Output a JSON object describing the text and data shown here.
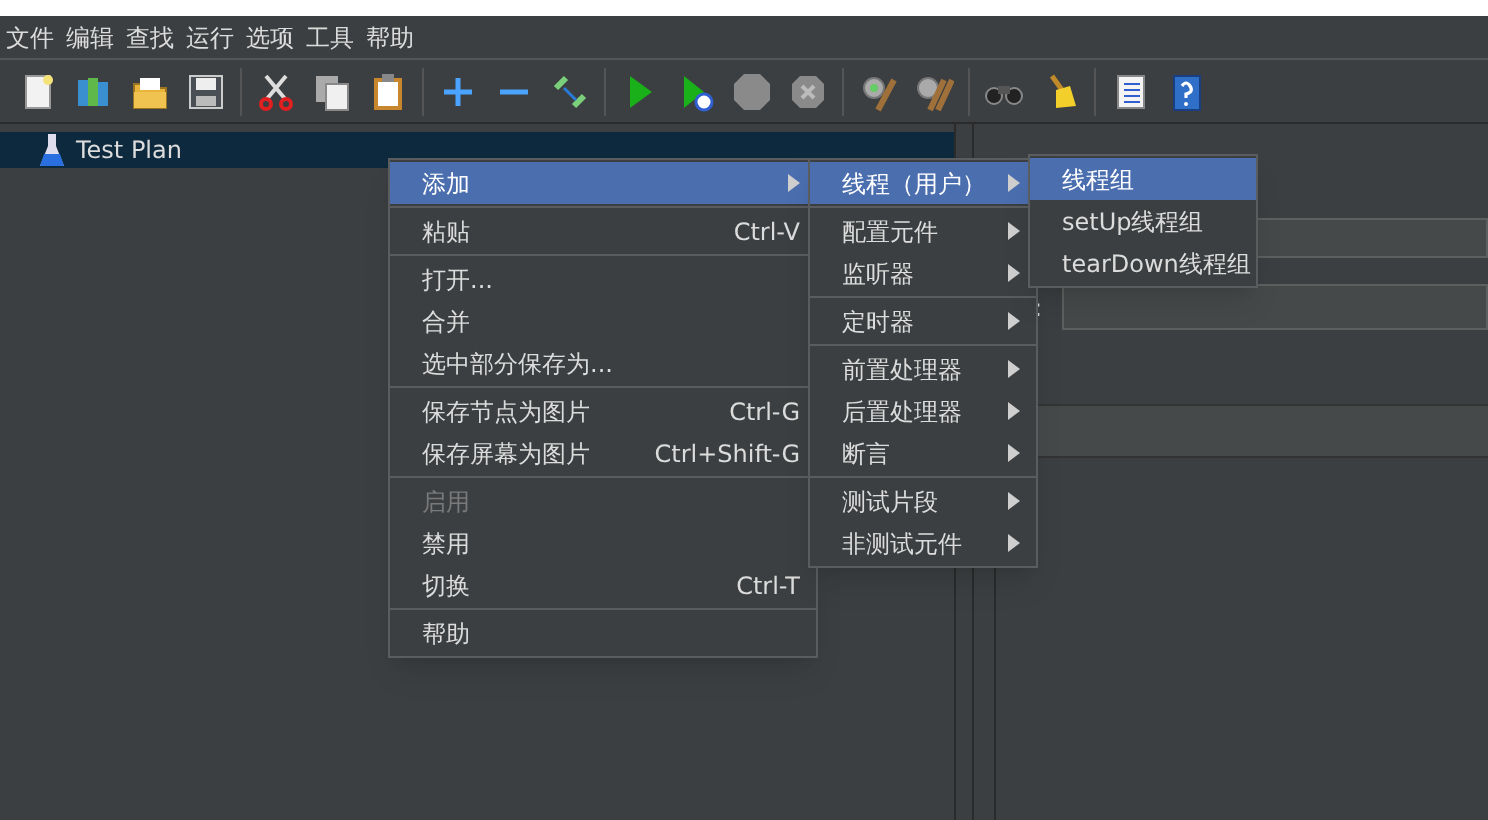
{
  "menubar": [
    {
      "label": "文件"
    },
    {
      "label": "编辑"
    },
    {
      "label": "查找"
    },
    {
      "label": "运行"
    },
    {
      "label": "选项"
    },
    {
      "label": "工具"
    },
    {
      "label": "帮助"
    }
  ],
  "tree": [
    {
      "label": "Test Plan",
      "selected": true
    }
  ],
  "right_pane": {
    "field_label": ":"
  },
  "context_menu": [
    [
      {
        "label": "添加",
        "submenu": true,
        "selected": true,
        "disabled": false
      }
    ],
    [
      {
        "label": "粘贴",
        "shortcut": "Ctrl-V",
        "submenu": false,
        "selected": false,
        "disabled": false
      }
    ],
    [
      {
        "label": "打开...",
        "submenu": false,
        "selected": false,
        "disabled": false
      },
      {
        "label": "合并",
        "submenu": false,
        "selected": false,
        "disabled": false
      },
      {
        "label": "选中部分保存为...",
        "submenu": false,
        "selected": false,
        "disabled": false
      }
    ],
    [
      {
        "label": "保存节点为图片",
        "shortcut": "Ctrl-G",
        "submenu": false,
        "selected": false,
        "disabled": false
      },
      {
        "label": "保存屏幕为图片",
        "shortcut": "Ctrl+Shift-G",
        "submenu": false,
        "selected": false,
        "disabled": false
      }
    ],
    [
      {
        "label": "启用",
        "submenu": false,
        "selected": false,
        "disabled": true
      },
      {
        "label": "禁用",
        "submenu": false,
        "selected": false,
        "disabled": false
      },
      {
        "label": "切换",
        "shortcut": "Ctrl-T",
        "submenu": false,
        "selected": false,
        "disabled": false
      }
    ],
    [
      {
        "label": "帮助",
        "submenu": false,
        "selected": false,
        "disabled": false
      }
    ]
  ],
  "add_submenu": [
    [
      {
        "label": "线程（用户）",
        "submenu": true,
        "selected": true
      }
    ],
    [
      {
        "label": "配置元件",
        "submenu": true,
        "selected": false
      },
      {
        "label": "监听器",
        "submenu": true,
        "selected": false
      }
    ],
    [
      {
        "label": "定时器",
        "submenu": true,
        "selected": false
      }
    ],
    [
      {
        "label": "前置处理器",
        "submenu": true,
        "selected": false
      },
      {
        "label": "后置处理器",
        "submenu": true,
        "selected": false
      },
      {
        "label": "断言",
        "submenu": true,
        "selected": false
      }
    ],
    [
      {
        "label": "测试片段",
        "submenu": true,
        "selected": false
      },
      {
        "label": "非测试元件",
        "submenu": true,
        "selected": false
      }
    ]
  ],
  "threads_submenu": [
    {
      "label": "线程组",
      "selected": true
    },
    {
      "label": "setUp线程组",
      "selected": false
    },
    {
      "label": "tearDown线程组",
      "selected": false
    }
  ]
}
